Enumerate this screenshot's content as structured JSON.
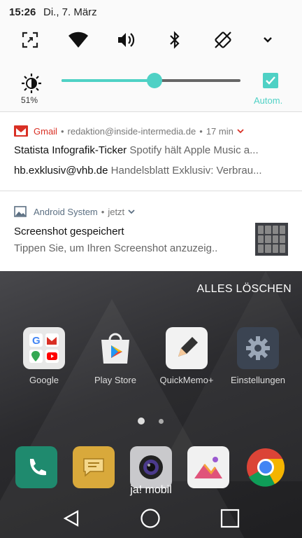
{
  "status": {
    "time": "15:26",
    "date": "Di., 7. März"
  },
  "quick_settings": {
    "icons": [
      "screen-capture-icon",
      "wifi-icon",
      "volume-icon",
      "bluetooth-icon",
      "auto-rotate-icon",
      "chevron-down-icon"
    ],
    "brightness_percent": "51%",
    "brightness_level": 0.52,
    "auto_label": "Autom."
  },
  "notifications": [
    {
      "app": "Gmail",
      "account": "redaktion@inside-intermedia.de",
      "time": "17 min",
      "lines": [
        {
          "sender": "Statista Infografik-Ticker",
          "preview": "Spotify hält Apple Music a..."
        },
        {
          "sender": "hb.exklusiv@vhb.de",
          "preview": "Handelsblatt Exklusiv: Verbrau..."
        }
      ]
    },
    {
      "app": "Android System",
      "time": "jetzt",
      "title": "Screenshot gespeichert",
      "text": "Tippen Sie, um Ihren Screenshot anzuzeig.."
    }
  ],
  "home": {
    "clear_all": "ALLES LÖSCHEN",
    "apps": [
      "Google",
      "Play Store",
      "QuickMemo+",
      "Einstellungen"
    ],
    "dock_label": "ja! mobil"
  },
  "colors": {
    "accent": "#4fd1c5",
    "gmail_red": "#d93025"
  }
}
